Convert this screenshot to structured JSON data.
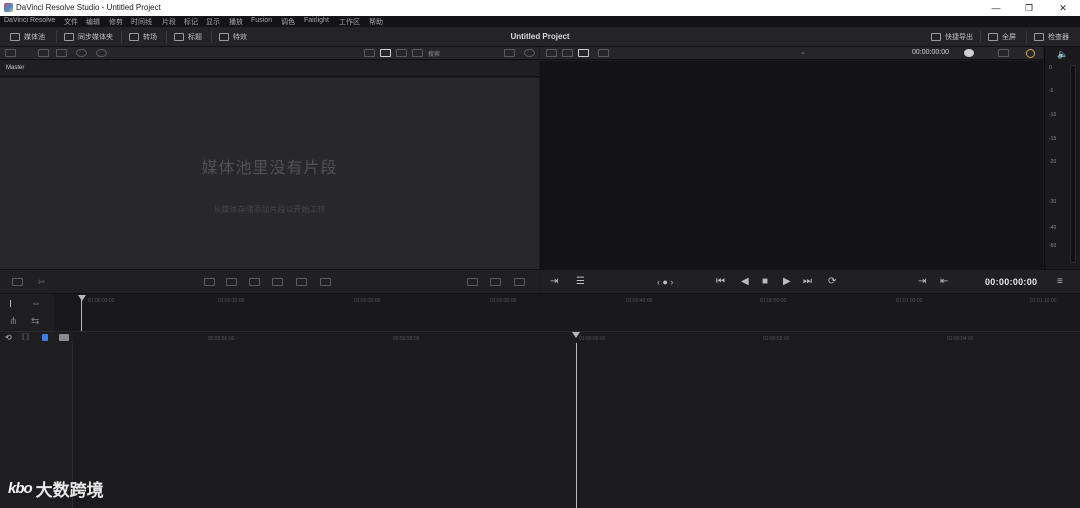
{
  "window": {
    "title": "DaVinci Resolve Studio - Untitled Project",
    "controls": {
      "minimize": "—",
      "maximize": "❐",
      "close": "✕"
    }
  },
  "menu": {
    "items": [
      "DaVinci Resolve",
      "文件",
      "编辑",
      "修剪",
      "时间线",
      "片段",
      "标记",
      "显示",
      "播放",
      "Fusion",
      "调色",
      "Fairlight",
      "工作区",
      "帮助"
    ]
  },
  "toolbar": {
    "left": [
      {
        "label": "媒体池",
        "icon": "media-pool-icon"
      },
      {
        "label": "同步媒体夹",
        "icon": "sync-bin-icon"
      },
      {
        "label": "转场",
        "icon": "transitions-icon"
      },
      {
        "label": "标题",
        "icon": "titles-icon"
      },
      {
        "label": "特效",
        "icon": "effects-icon"
      }
    ],
    "project_title": "Untitled Project",
    "right": [
      {
        "label": "快捷导出",
        "icon": "quick-export-icon"
      },
      {
        "label": "全屏",
        "icon": "fullscreen-icon"
      },
      {
        "label": "检查器",
        "icon": "inspector-icon"
      }
    ]
  },
  "media_pool": {
    "search_placeholder": "搜索",
    "bin_name": "Master",
    "empty_title": "媒体池里没有片段",
    "empty_subtitle": "从媒体存储添加片段以开始工作"
  },
  "viewer": {
    "timecode": "00:00:00:00",
    "transport_timecode": "00:00:00:00",
    "audio_meter_labels": [
      "0",
      "-5",
      "-10",
      "-15",
      "-20",
      "-30",
      "-40",
      "-50"
    ]
  },
  "timeline": {
    "upper_ruler_ticks": [
      "01:00:00:00",
      "01:00:10:00",
      "01:00:20:00",
      "01:00:30:00",
      "01:00:40:00",
      "01:00:50:00",
      "01:01:00:00",
      "01:01:10:00"
    ],
    "lower_ruler_ticks": [
      "00:59:56:00",
      "00:59:58:00",
      "01:00:00:00",
      "01:00:02:00",
      "01:00:04:00"
    ]
  },
  "watermark": {
    "logo": "kbo",
    "text": "大数跨境"
  },
  "colors": {
    "accent_blue": "#3b7de0",
    "background": "#1c1c1f",
    "panel": "#28282c"
  }
}
